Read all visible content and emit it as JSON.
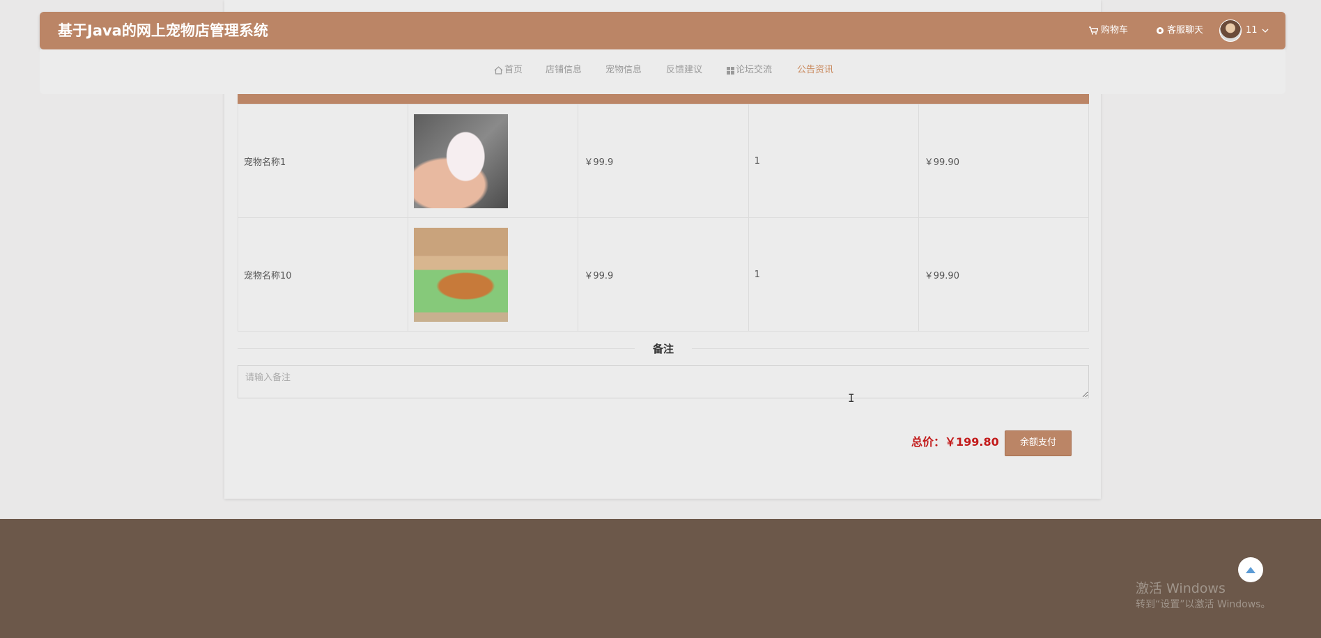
{
  "header": {
    "site_title": "基于Java的网上宠物店管理系统",
    "cart_label": "购物车",
    "service_label": "客服聊天",
    "username": "11",
    "cart_icon": "cart-icon",
    "service_icon": "headset-icon",
    "dropdown_icon": "chevron-down-icon"
  },
  "nav": {
    "items": [
      {
        "label": "首页",
        "icon": "home-icon"
      },
      {
        "label": "店铺信息"
      },
      {
        "label": "宠物信息"
      },
      {
        "label": "反馈建议"
      },
      {
        "label": "论坛交流",
        "icon": "grid-icon"
      },
      {
        "label": "公告资讯",
        "active": true
      }
    ]
  },
  "cart_table": {
    "rows": [
      {
        "name": "宠物名称1",
        "image": "hamster-photo",
        "price": "￥99.9",
        "quantity": "1",
        "subtotal": "￥99.90"
      },
      {
        "name": "宠物名称10",
        "image": "corgi-photo",
        "price": "￥99.9",
        "quantity": "1",
        "subtotal": "￥99.90"
      }
    ]
  },
  "remark": {
    "section_label": "备注",
    "placeholder": "请输入备注"
  },
  "checkout": {
    "total_text": "总价：￥199.80",
    "pay_button": "余额支付"
  },
  "watermark": {
    "line1": "激活 Windows",
    "line2": "转到“设置”以激活 Windows。"
  },
  "colors": {
    "brand": "#bb8566",
    "total": "#c21a1a",
    "footer": "#6c584a"
  }
}
